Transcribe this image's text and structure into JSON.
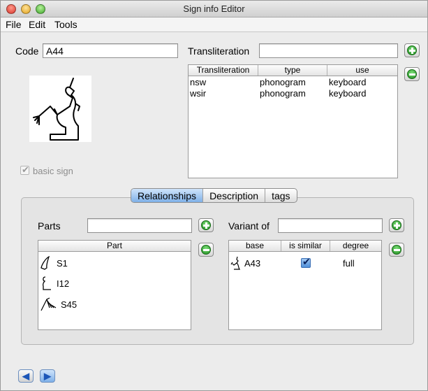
{
  "window": {
    "title": "Sign info Editor"
  },
  "menu": {
    "file": "File",
    "edit": "Edit",
    "tools": "Tools"
  },
  "code": {
    "label": "Code",
    "value": "A44"
  },
  "transliteration": {
    "label": "Transliteration",
    "value": ""
  },
  "transliteration_table": {
    "headers": [
      "Transliteration",
      "type",
      "use"
    ],
    "rows": [
      [
        "nsw",
        "phonogram",
        "keyboard"
      ],
      [
        "wsir",
        "phonogram",
        "keyboard"
      ]
    ]
  },
  "basic_sign": {
    "label": "basic sign",
    "checked": true,
    "enabled": false
  },
  "tabs": [
    "Relationships",
    "Description",
    "tags"
  ],
  "active_tab": "Relationships",
  "parts": {
    "label": "Parts",
    "value": "",
    "header": "Part",
    "items": [
      {
        "code": "S1",
        "icon": "white-crown-glyph-icon"
      },
      {
        "code": "I12",
        "icon": "cobra-glyph-icon"
      },
      {
        "code": "S45",
        "icon": "flail-glyph-icon"
      }
    ]
  },
  "variant_of": {
    "label": "Variant of",
    "value": "",
    "headers": [
      "base",
      "is similar",
      "degree"
    ],
    "rows": [
      {
        "base": "A43",
        "is_similar": true,
        "degree": "full",
        "icon": "seated-king-glyph-icon"
      }
    ]
  },
  "colors": {
    "accent": "#7fb0e8",
    "add_button": "#1c8a1c"
  }
}
